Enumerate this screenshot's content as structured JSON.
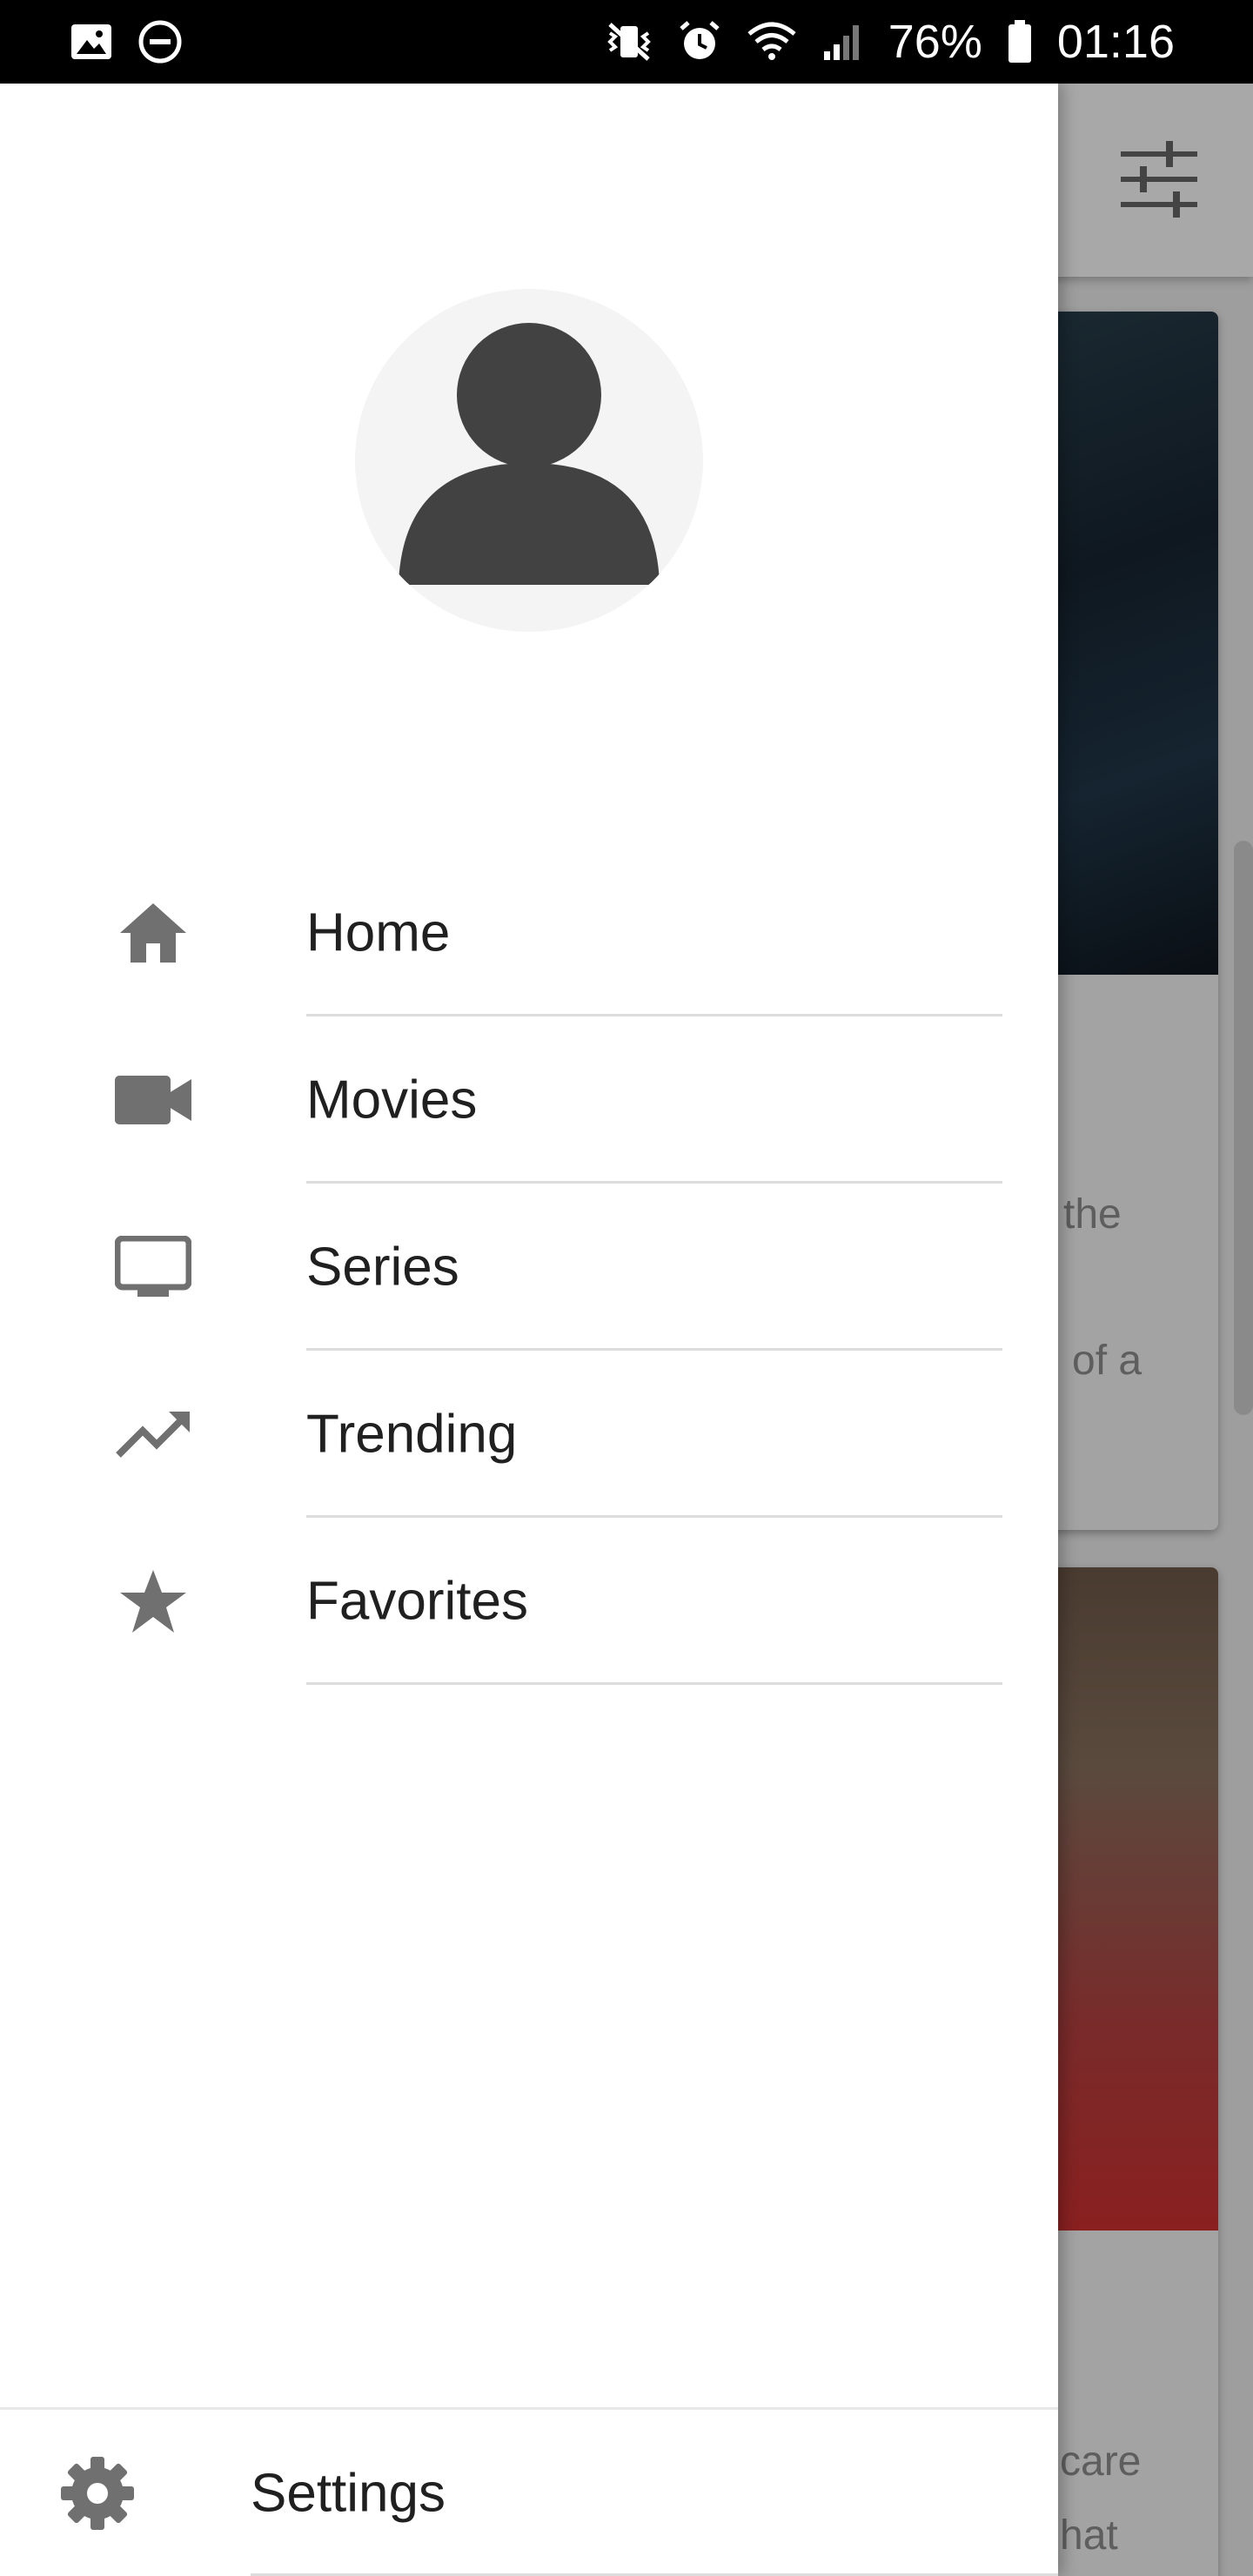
{
  "status_bar": {
    "battery": "76%",
    "time": "01:16"
  },
  "background": {
    "card1_text_line1": "the",
    "card1_text_line2": "of a",
    "card2_text_line1": "care",
    "card2_text_line2": "hat"
  },
  "drawer": {
    "menu": [
      {
        "label": "Home",
        "icon": "home-icon"
      },
      {
        "label": "Movies",
        "icon": "videocam-icon"
      },
      {
        "label": "Series",
        "icon": "tv-icon"
      },
      {
        "label": "Trending",
        "icon": "trending-up-icon"
      },
      {
        "label": "Favorites",
        "icon": "star-icon"
      }
    ],
    "settings_label": "Settings"
  },
  "colors": {
    "drawer_bg": "#ffffff",
    "icon": "#707070",
    "avatar": "#424242",
    "scrim": "#9e9e9e"
  }
}
